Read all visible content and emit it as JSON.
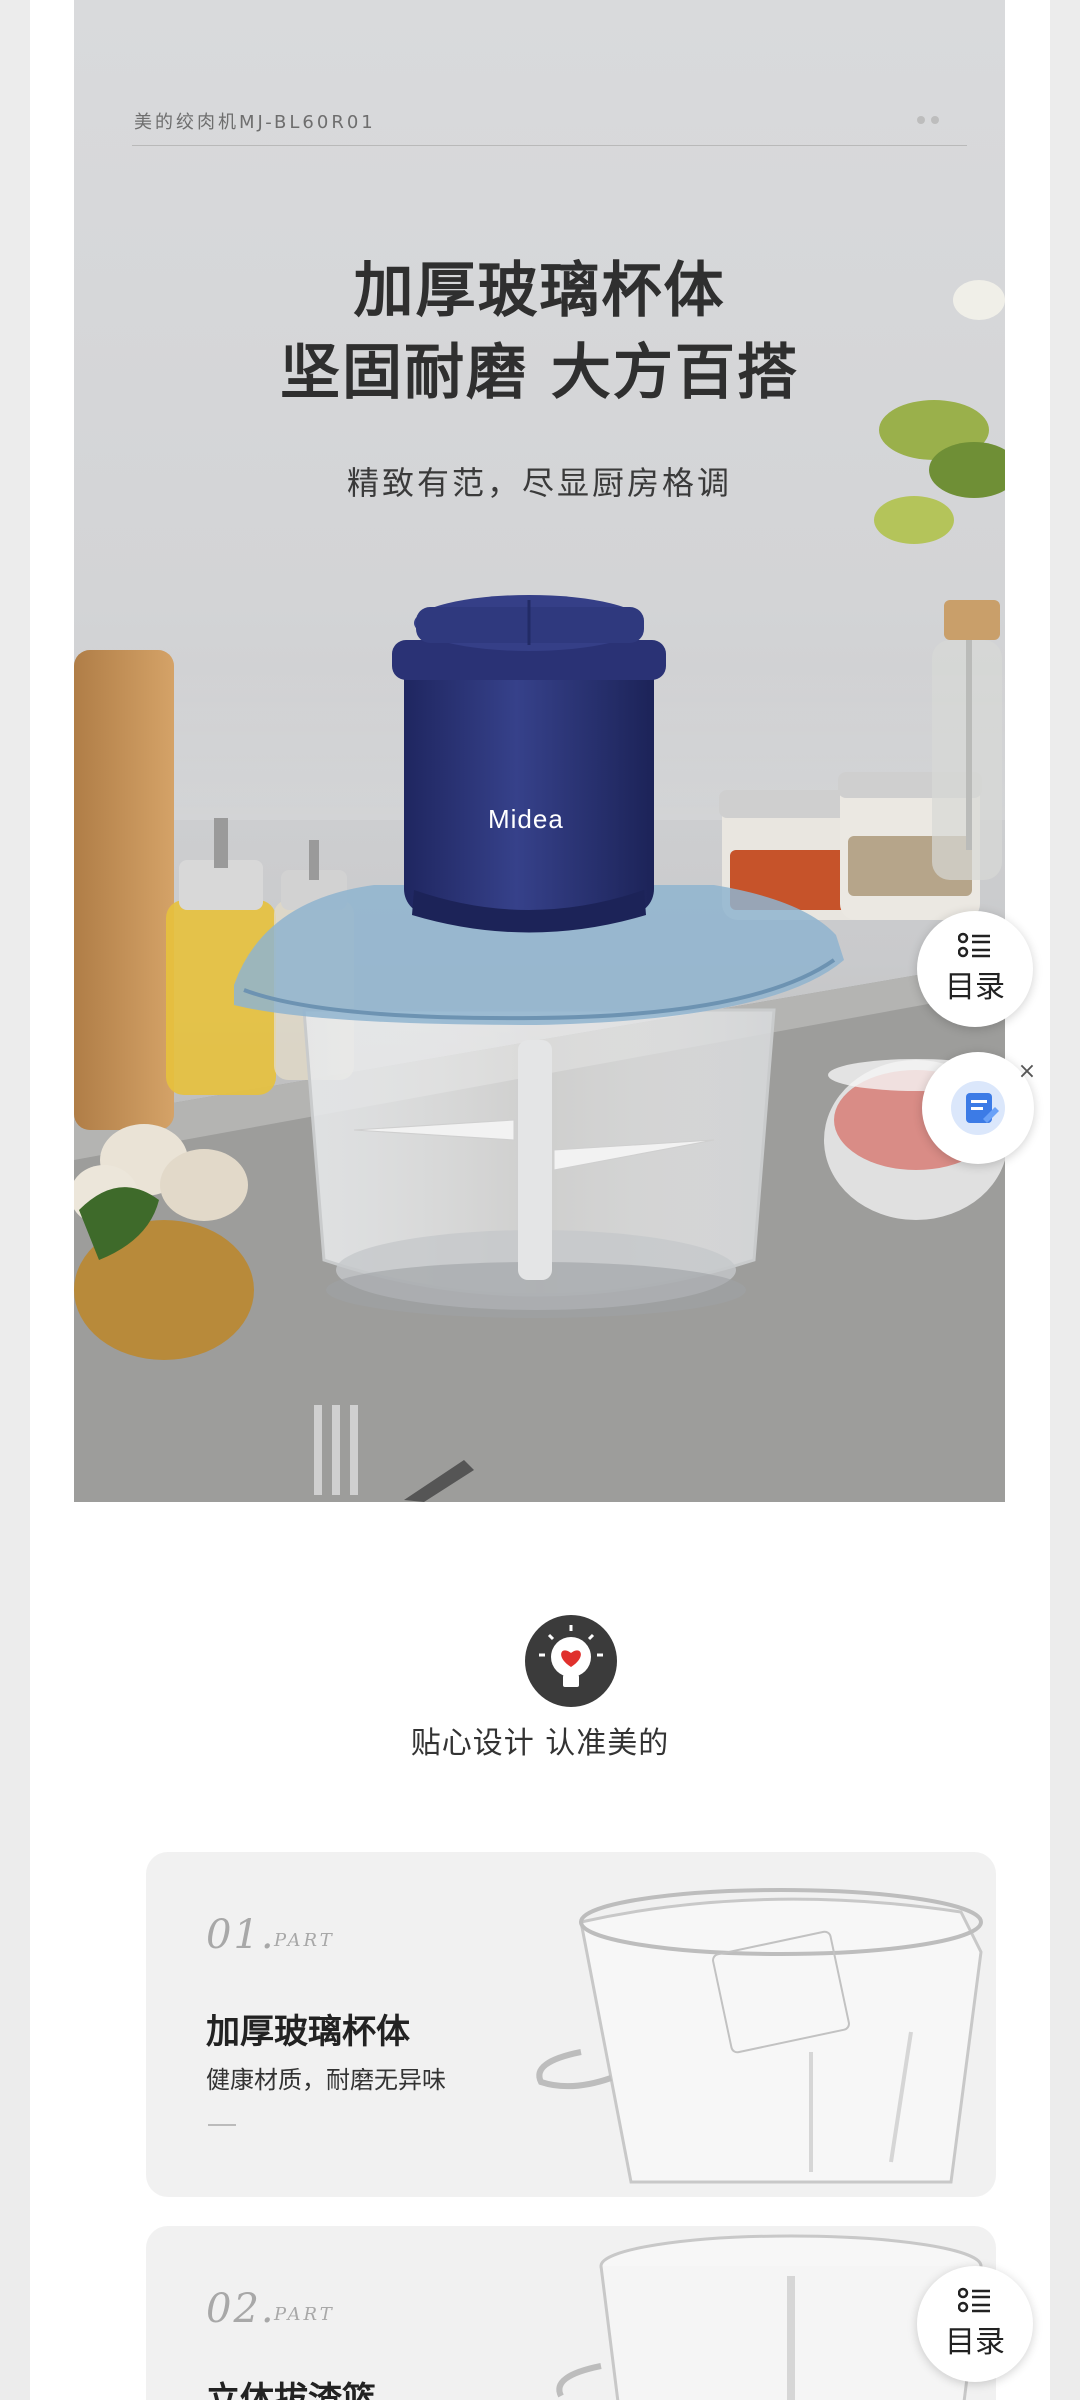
{
  "hero": {
    "caption": "美的绞肉机MJ-BL60R01",
    "title_line1": "加厚玻璃杯体",
    "title_line2": "坚固耐磨 大方百搭",
    "subtitle": "精致有范，尽显厨房格调",
    "brand_logo": "Midea"
  },
  "floating": {
    "toc_label": "目录",
    "toc_icon": "list-icon",
    "doc_icon": "document-icon",
    "close_glyph": "×"
  },
  "feature": {
    "heading": "贴心设计 认准美的",
    "badge_icon": "heart-bulb-icon",
    "cards": [
      {
        "num": "01.",
        "part": "PART",
        "title": "加厚玻璃杯体",
        "desc": "健康材质，耐磨无异味"
      },
      {
        "num": "02.",
        "part": "PART",
        "title": "立体拔渣篮",
        "desc": ""
      }
    ]
  },
  "colors": {
    "accent_blue": "#2b3470",
    "heart_red": "#e0302c",
    "badge_dark": "#3b3b3b"
  }
}
